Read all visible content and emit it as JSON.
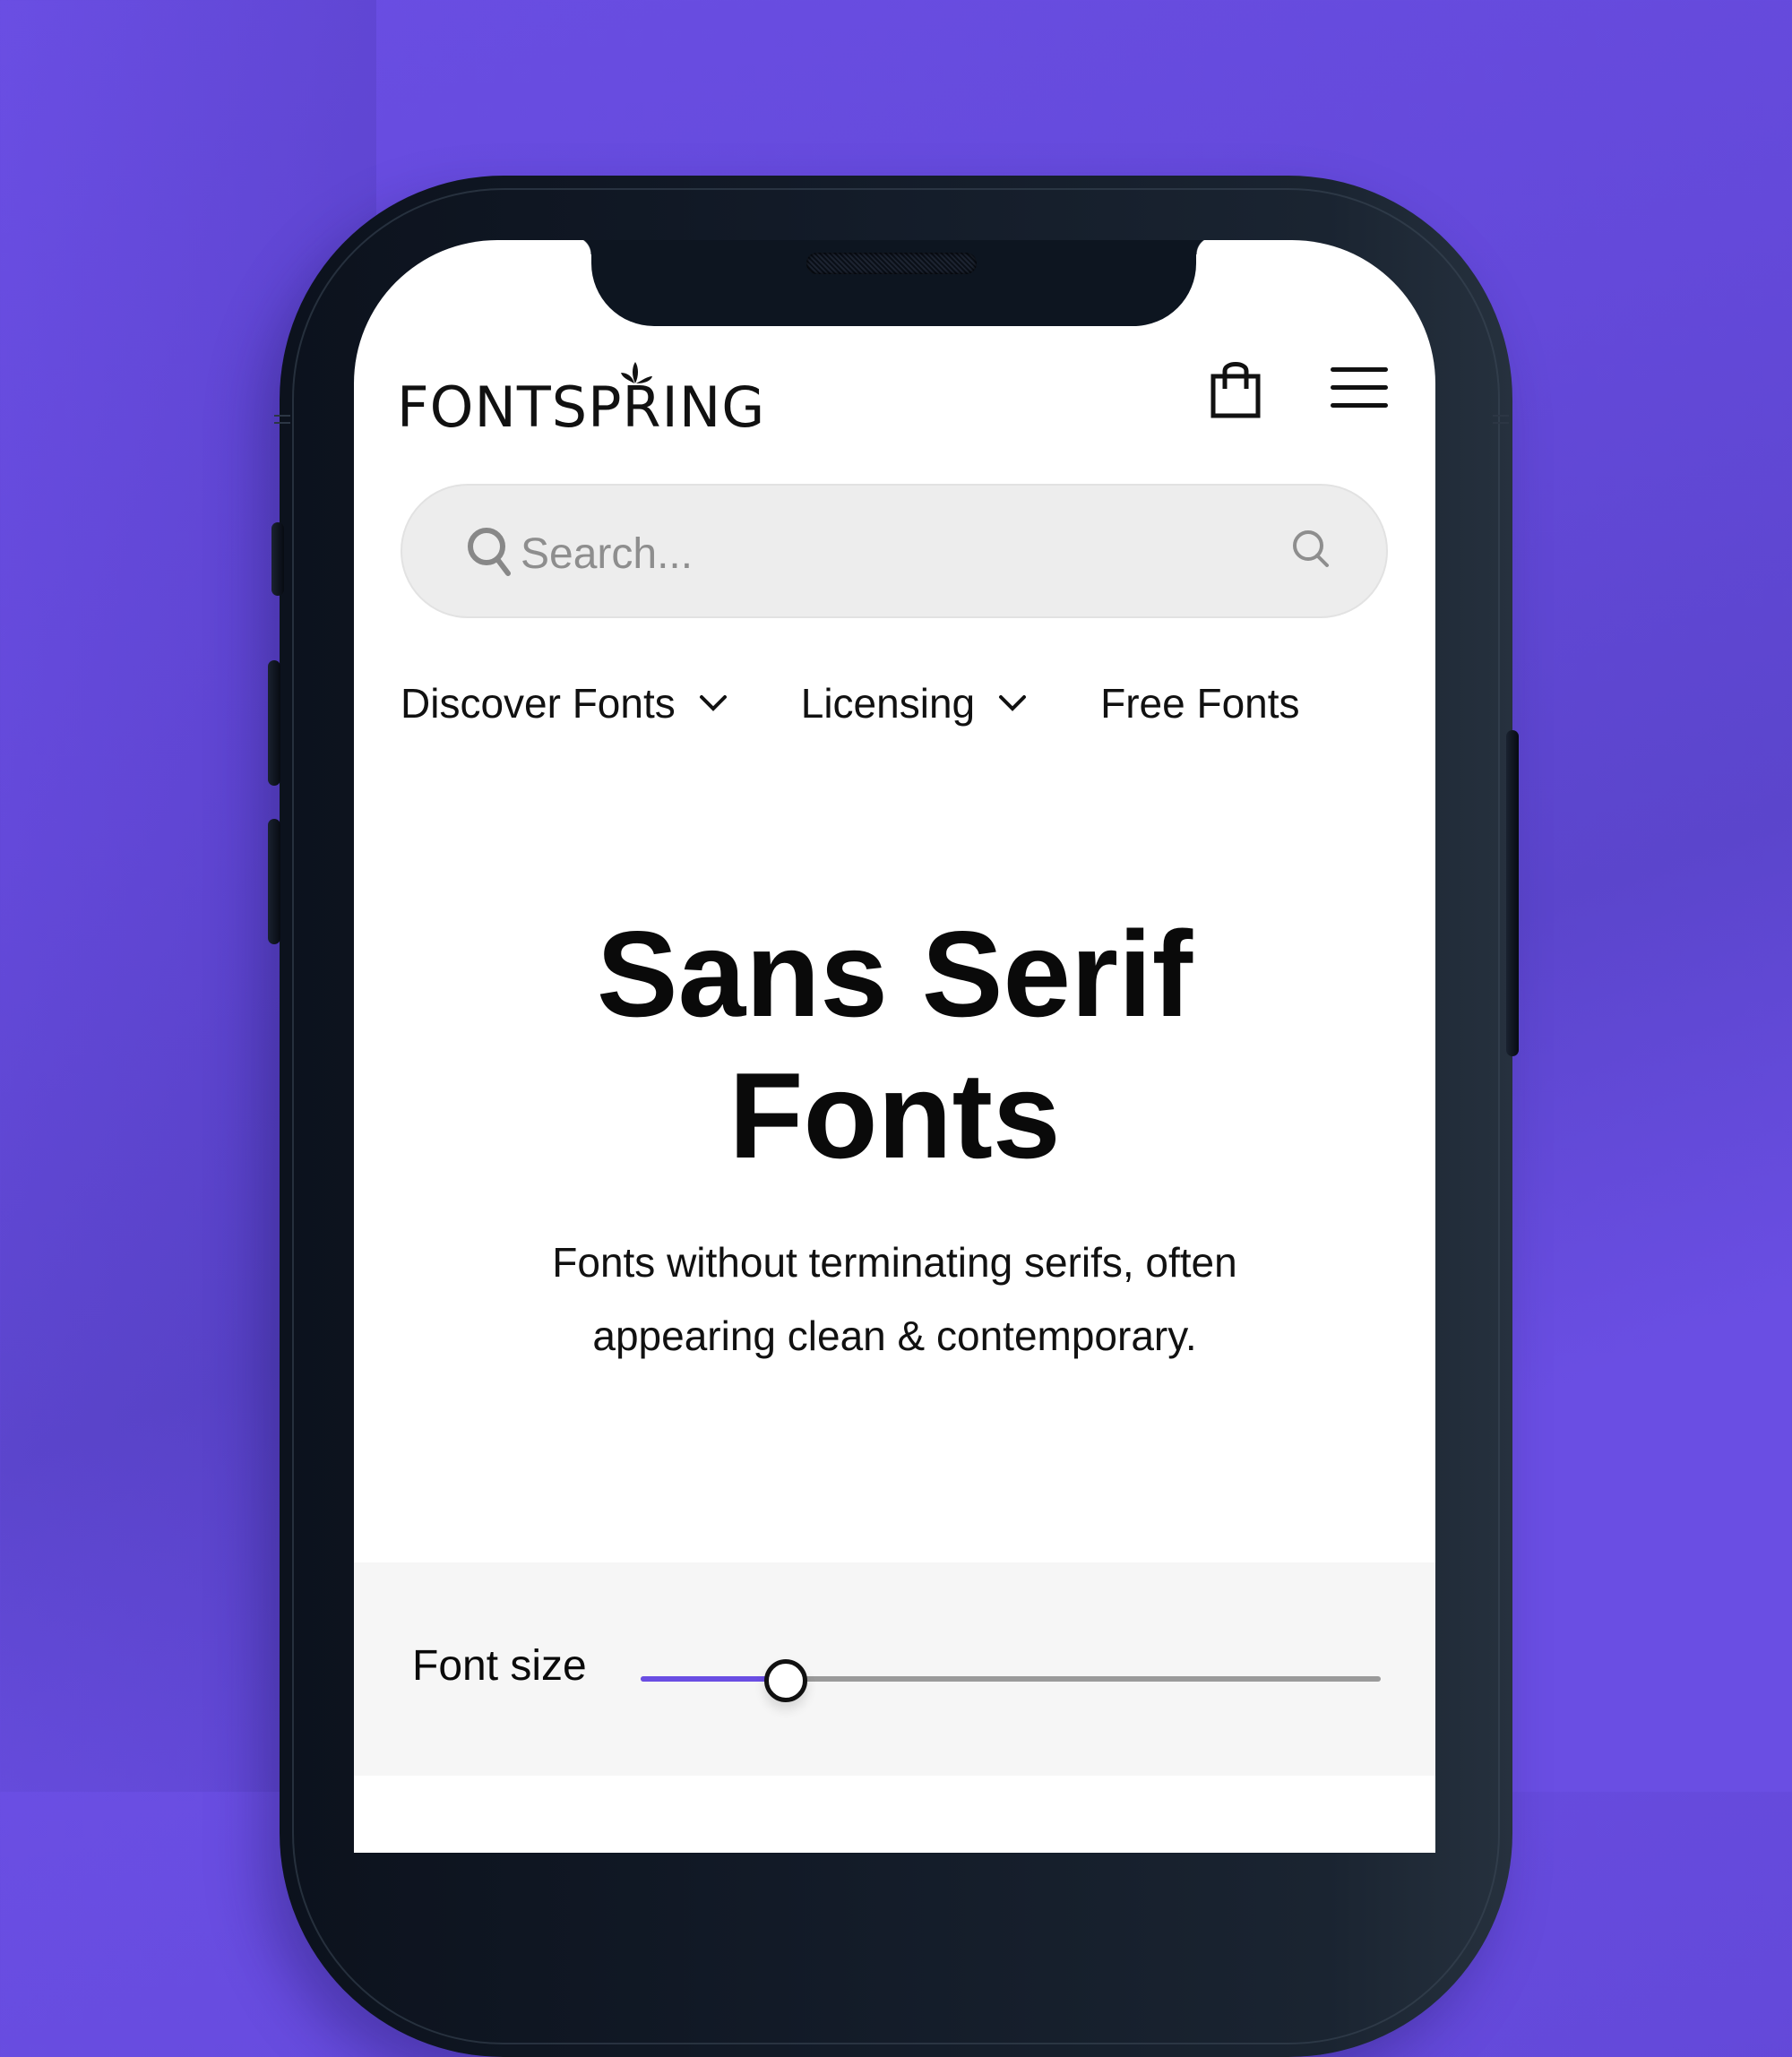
{
  "background": {
    "color": "#6a4ee3"
  },
  "header": {
    "logo_text": "FONTSPRING",
    "cart_icon": "shopping-bag-icon",
    "menu_icon": "hamburger-menu-icon"
  },
  "search": {
    "placeholder": "Search...",
    "value": "",
    "left_icon": "search-icon",
    "right_icon": "search-icon"
  },
  "nav": {
    "items": [
      {
        "label": "Discover Fonts",
        "has_dropdown": true
      },
      {
        "label": "Licensing",
        "has_dropdown": true
      },
      {
        "label": "Free Fonts",
        "has_dropdown": false
      }
    ]
  },
  "hero": {
    "title_line1": "Sans Serif",
    "title_line2": "Fonts",
    "description_line1": "Fonts without terminating serifs, often",
    "description_line2": "appearing clean & contemporary."
  },
  "controls": {
    "font_size_label": "Font size",
    "font_size_slider_fraction": 0.19,
    "accent_color": "#6a4ee3",
    "track_color": "#9a9a9a"
  }
}
